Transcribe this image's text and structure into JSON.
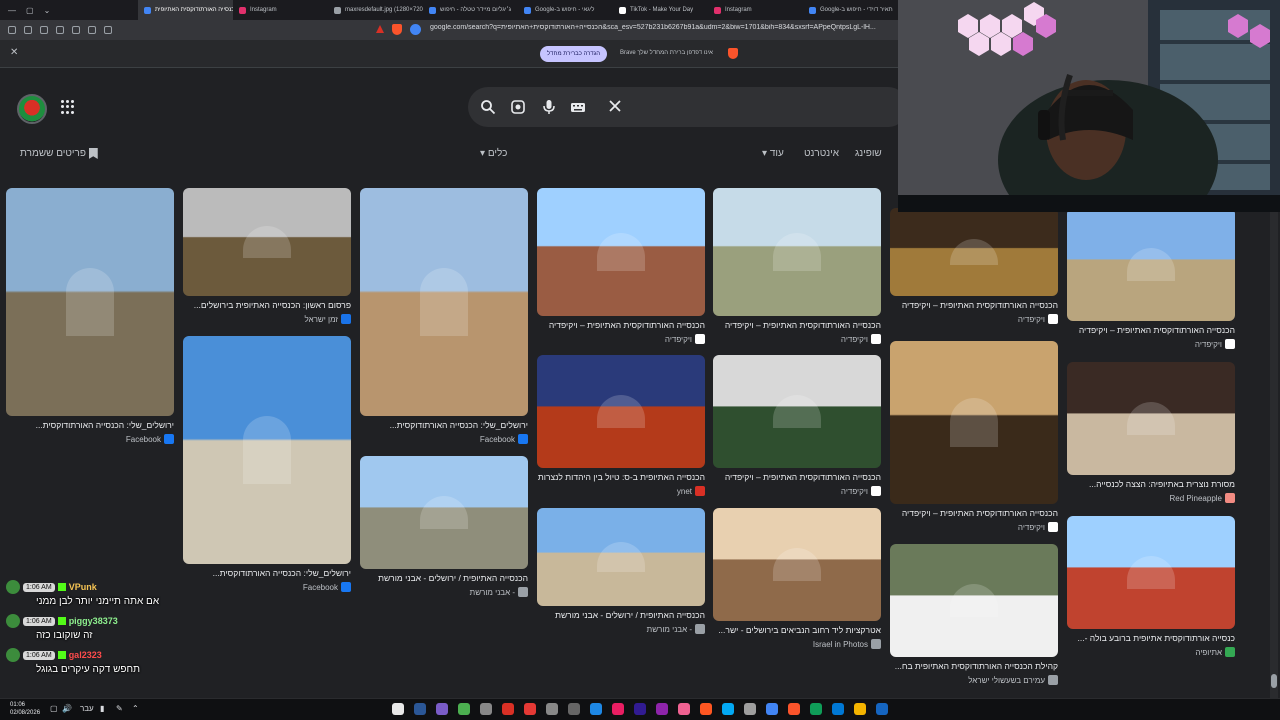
{
  "tabs": [
    {
      "label": "תאיר דוידי - חיפוש ב-Google",
      "color": "#4285f4"
    },
    {
      "label": "Instagram",
      "color": "#e1306c"
    },
    {
      "label": "TikTok - Make Your Day",
      "color": "#ffffff"
    },
    {
      "label": "ליגאי - חיפוש ב-Google",
      "color": "#4285f4"
    },
    {
      "label": "ג׳יגליום מיידר טטלה - חיפוש",
      "color": "#4285f4"
    },
    {
      "label": "maxresdefault.jpg (1280×720)",
      "color": "#9aa0a6"
    },
    {
      "label": "Instagram",
      "color": "#e1306c"
    },
    {
      "label": "הכנסייה האורתודוקסית האתיופית",
      "color": "#4285f4",
      "active": true
    }
  ],
  "address": "google.com/search?q=הכנסייה+האורתודוקסית+האתיופית&sca_esv=527b231b6267b91a&udm=2&biw=1701&bih=834&sxsrf=APpeQntpsLgL-lH...",
  "brave": {
    "text": "Brave אינו דפדפן ברירת המחדל שלך",
    "button": "הגדרה כברירת מחדל"
  },
  "filters": {
    "all": "שופינג",
    "internet": "אינטרנט",
    "more": "עוד",
    "tools": "כלים",
    "saved": "פריטים ששמרת"
  },
  "results": [
    {
      "title": "ירושלים_שלי: הכנסייה האורתודוקסית...",
      "source": "Facebook",
      "srccolor": "#1877f2"
    },
    {
      "title": "פרסום ראשון: הכנסייה האתיופית בירושלים...",
      "source": "זמן ישראל",
      "srccolor": "#1a73e8"
    },
    {
      "title": "ירושלים_שלי: הכנסייה האורתודוקסית...",
      "source": "Facebook",
      "srccolor": "#1877f2"
    },
    {
      "title": "הכנסייה האורתודוקסית האתיופית – ויקיפדיה",
      "source": "ויקיפדיה",
      "srccolor": "#ffffff"
    },
    {
      "title": "הכנסייה האורתודוקסית האתיופית – ויקיפדיה",
      "source": "ויקיפדיה",
      "srccolor": "#ffffff"
    },
    {
      "title": "הכנסייה האורתודוקסית האתיופית – ויקיפדיה",
      "source": "ויקיפדיה",
      "srccolor": "#ffffff"
    },
    {
      "title": "הכנסייה האורתודוקסית האתיופית – ויקיפדיה",
      "source": "ויקיפדיה",
      "srccolor": "#ffffff"
    },
    {
      "title": "ירושלים_שלי: הכנסייה האורתודוקסית...",
      "source": "Facebook",
      "srccolor": "#1877f2"
    },
    {
      "title": "הכנסייה האתיופית / ירושלים - אבני מורשת",
      "source": "אבני מורשת -",
      "srccolor": "#9aa0a6"
    },
    {
      "title": "הכנסייה האתיופית ב-ס: טיול בין היהדות לנצרות",
      "source": "ynet",
      "srccolor": "#d93025"
    },
    {
      "title": "הכנסייה האורתודוקסית האתיופית – ויקיפדיה",
      "source": "ויקיפדיה",
      "srccolor": "#ffffff"
    },
    {
      "title": "הכנסייה האורתודוקסית האתיופית – ויקיפדיה",
      "source": "ויקיפדיה",
      "srccolor": "#ffffff"
    },
    {
      "title": "מסורת נוצרית באתיופיה: הצצה לכנסייה...",
      "source": "Red Pineapple",
      "srccolor": "#f28b82"
    },
    {
      "title": "הכנסייה האתיופית / ירושלים - אבני מורשת",
      "source": "אבני מורשת -",
      "srccolor": "#9aa0a6"
    },
    {
      "title": "אטרקציות ליד רחוב הנביאים בירושלים - ישר...",
      "source": "Israel in Photos",
      "srccolor": "#9aa0a6"
    },
    {
      "title": "קהילת הכנסייה האורתודוקסית האתיופית בח...",
      "source": "עמירם בשעשולי ישראל",
      "srccolor": "#9aa0a6"
    },
    {
      "title": "כנסייה אורתודוקסית אתיופית ברובע בולה -...",
      "source": "אתיופיה",
      "srccolor": "#34a853"
    }
  ],
  "chat": [
    {
      "time": "1:06 AM",
      "name": "VPunk",
      "namecolor": "#f6c453",
      "msg": "אם אתה תיימני יותר לבן ממני"
    },
    {
      "time": "1:06 AM",
      "name": "piggy38373",
      "namecolor": "#8ef08e",
      "msg": "זה שוקובו כזה"
    },
    {
      "time": "1:06 AM",
      "name": "gal2323",
      "namecolor": "#ff4b4b",
      "msg": "תחפש דקה עיקרים בגוגל"
    }
  ],
  "taskbar": {
    "time": "01:06",
    "date": "02/08/2026",
    "lang": "עבר"
  },
  "accent": "#8ab4f8"
}
